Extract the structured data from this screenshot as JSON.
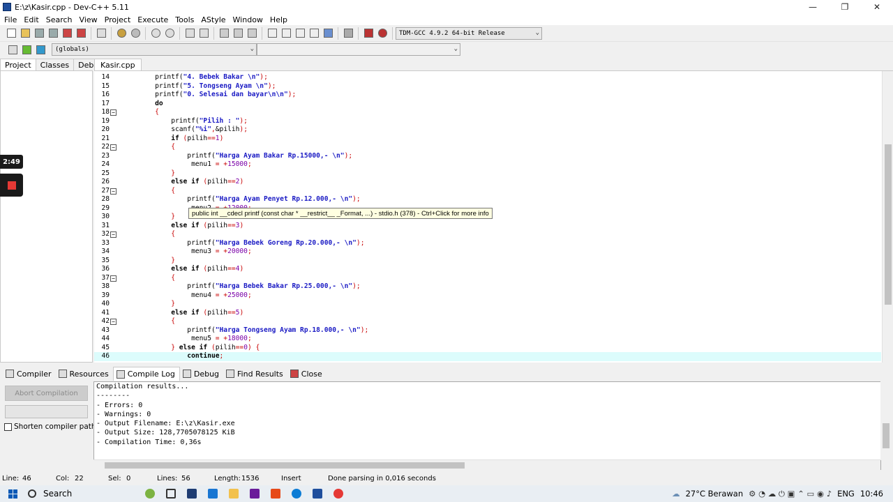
{
  "window": {
    "title": "E:\\z\\Kasir.cpp - Dev-C++ 5.11",
    "minimize": "—",
    "maximize": "❐",
    "close": "✕"
  },
  "menu": [
    "File",
    "Edit",
    "Search",
    "View",
    "Project",
    "Execute",
    "Tools",
    "AStyle",
    "Window",
    "Help"
  ],
  "toolbar": {
    "compiler_select": "TDM-GCC 4.9.2 64-bit Release",
    "scope_select": "(globals)",
    "member_select": ""
  },
  "left_tabs": [
    "Project",
    "Classes",
    "Debug"
  ],
  "editor_tab": "Kasir.cpp",
  "code_lines": [
    {
      "n": "14",
      "fold": "",
      "segs": [
        [
          "",
          "    printf("
        ],
        [
          "s",
          "\"4. Bebek Bakar \\n\""
        ],
        [
          "p",
          ");"
        ]
      ]
    },
    {
      "n": "15",
      "fold": "",
      "segs": [
        [
          "",
          "    printf("
        ],
        [
          "s",
          "\"5. Tongseng Ayam \\n\""
        ],
        [
          "p",
          ");"
        ]
      ]
    },
    {
      "n": "16",
      "fold": "",
      "segs": [
        [
          "",
          "    printf("
        ],
        [
          "s",
          "\"0. Selesai dan bayar\\n\\n\""
        ],
        [
          "p",
          ");"
        ]
      ]
    },
    {
      "n": "17",
      "fold": "",
      "segs": [
        [
          "k",
          "    do"
        ]
      ]
    },
    {
      "n": "18",
      "fold": "−",
      "segs": [
        [
          "p",
          "    {"
        ]
      ]
    },
    {
      "n": "19",
      "fold": "",
      "segs": [
        [
          "",
          "        printf("
        ],
        [
          "s",
          "\"Pilih : \""
        ],
        [
          "p",
          ");"
        ]
      ]
    },
    {
      "n": "20",
      "fold": "",
      "segs": [
        [
          "",
          "        scanf("
        ],
        [
          "s",
          "\"%i\""
        ],
        [
          "p",
          ","
        ],
        [
          "",
          "&pilih"
        ],
        [
          "p",
          ");"
        ]
      ]
    },
    {
      "n": "21",
      "fold": "",
      "segs": [
        [
          "k",
          "        if "
        ],
        [
          "p",
          "("
        ],
        [
          "",
          "pilih"
        ],
        [
          "p",
          "=="
        ],
        [
          "n",
          "1"
        ],
        [
          "p",
          ")"
        ]
      ]
    },
    {
      "n": "22",
      "fold": "−",
      "segs": [
        [
          "p",
          "        {"
        ]
      ]
    },
    {
      "n": "23",
      "fold": "",
      "segs": [
        [
          "",
          "            printf("
        ],
        [
          "s",
          "\"Harga Ayam Bakar Rp.15000,- \\n\""
        ],
        [
          "p",
          ");"
        ]
      ]
    },
    {
      "n": "24",
      "fold": "",
      "segs": [
        [
          "",
          "             menu1 "
        ],
        [
          "p",
          "= +"
        ],
        [
          "n",
          "15000"
        ],
        [
          "p",
          ";"
        ]
      ]
    },
    {
      "n": "25",
      "fold": "",
      "segs": [
        [
          "p",
          "        }"
        ]
      ]
    },
    {
      "n": "26",
      "fold": "",
      "segs": [
        [
          "k",
          "        else if "
        ],
        [
          "p",
          "("
        ],
        [
          "",
          "pilih"
        ],
        [
          "p",
          "=="
        ],
        [
          "n",
          "2"
        ],
        [
          "p",
          ")"
        ]
      ]
    },
    {
      "n": "27",
      "fold": "−",
      "segs": [
        [
          "p",
          "        {"
        ]
      ]
    },
    {
      "n": "28",
      "fold": "",
      "segs": [
        [
          "",
          "            printf("
        ],
        [
          "s",
          "\"Harga Ayam Penyet Rp.12.000,- \\n\""
        ],
        [
          "p",
          ");"
        ]
      ]
    },
    {
      "n": "29",
      "fold": "",
      "segs": [
        [
          "",
          "             menu2 "
        ],
        [
          "p",
          "= +"
        ],
        [
          "n",
          "12000"
        ],
        [
          "p",
          ";"
        ]
      ]
    },
    {
      "n": "30",
      "fold": "",
      "segs": [
        [
          "p",
          "        }"
        ]
      ]
    },
    {
      "n": "31",
      "fold": "",
      "segs": [
        [
          "k",
          "        else if "
        ],
        [
          "p",
          "("
        ],
        [
          "",
          "pilih"
        ],
        [
          "p",
          "=="
        ],
        [
          "n",
          "3"
        ],
        [
          "p",
          ")"
        ]
      ]
    },
    {
      "n": "32",
      "fold": "−",
      "segs": [
        [
          "p",
          "        {"
        ]
      ]
    },
    {
      "n": "33",
      "fold": "",
      "segs": [
        [
          "",
          "            printf("
        ],
        [
          "s",
          "\"Harga Bebek Goreng Rp.20.000,- \\n\""
        ],
        [
          "p",
          ");"
        ]
      ]
    },
    {
      "n": "34",
      "fold": "",
      "segs": [
        [
          "",
          "             menu3 "
        ],
        [
          "p",
          "= +"
        ],
        [
          "n",
          "20000"
        ],
        [
          "p",
          ";"
        ]
      ]
    },
    {
      "n": "35",
      "fold": "",
      "segs": [
        [
          "p",
          "        }"
        ]
      ]
    },
    {
      "n": "36",
      "fold": "",
      "segs": [
        [
          "k",
          "        else if "
        ],
        [
          "p",
          "("
        ],
        [
          "",
          "pilih"
        ],
        [
          "p",
          "=="
        ],
        [
          "n",
          "4"
        ],
        [
          "p",
          ")"
        ]
      ]
    },
    {
      "n": "37",
      "fold": "−",
      "segs": [
        [
          "p",
          "        {"
        ]
      ]
    },
    {
      "n": "38",
      "fold": "",
      "segs": [
        [
          "",
          "            printf("
        ],
        [
          "s",
          "\"Harga Bebek Bakar Rp.25.000,- \\n\""
        ],
        [
          "p",
          ");"
        ]
      ]
    },
    {
      "n": "39",
      "fold": "",
      "segs": [
        [
          "",
          "             menu4 "
        ],
        [
          "p",
          "= +"
        ],
        [
          "n",
          "25000"
        ],
        [
          "p",
          ";"
        ]
      ]
    },
    {
      "n": "40",
      "fold": "",
      "segs": [
        [
          "p",
          "        }"
        ]
      ]
    },
    {
      "n": "41",
      "fold": "",
      "segs": [
        [
          "k",
          "        else if "
        ],
        [
          "p",
          "("
        ],
        [
          "",
          "pilih"
        ],
        [
          "p",
          "=="
        ],
        [
          "n",
          "5"
        ],
        [
          "p",
          ")"
        ]
      ]
    },
    {
      "n": "42",
      "fold": "−",
      "segs": [
        [
          "p",
          "        {"
        ]
      ]
    },
    {
      "n": "43",
      "fold": "",
      "segs": [
        [
          "",
          "            printf("
        ],
        [
          "s",
          "\"Harga Tongseng Ayam Rp.18.000,- \\n\""
        ],
        [
          "p",
          ");"
        ]
      ]
    },
    {
      "n": "44",
      "fold": "",
      "segs": [
        [
          "",
          "             menu5 "
        ],
        [
          "p",
          "= +"
        ],
        [
          "n",
          "18000"
        ],
        [
          "p",
          ";"
        ]
      ]
    },
    {
      "n": "45",
      "fold": "",
      "segs": [
        [
          "p",
          "        } "
        ],
        [
          "k",
          "else if "
        ],
        [
          "p",
          "("
        ],
        [
          "",
          "pilih"
        ],
        [
          "p",
          "=="
        ],
        [
          "n",
          "0"
        ],
        [
          "p",
          ") {"
        ]
      ]
    },
    {
      "n": "46",
      "fold": "",
      "segs": [
        [
          "k",
          "            continue"
        ],
        [
          "p",
          ";"
        ]
      ]
    }
  ],
  "tooltip": "public int __cdecl printf (const char * __restrict__ _Format, ...) - stdio.h (378) - Ctrl+Click for more info",
  "recorder": {
    "time": "2:49"
  },
  "bottom_tabs": [
    "Compiler",
    "Resources",
    "Compile Log",
    "Debug",
    "Find Results",
    "Close"
  ],
  "abort_button": "Abort Compilation",
  "shorten_paths": "Shorten compiler paths",
  "log_lines": [
    "Compilation results...",
    "--------",
    "- Errors: 0",
    "- Warnings: 0",
    "- Output Filename: E:\\z\\Kasir.exe",
    "- Output Size: 128,7705078125 KiB",
    "- Compilation Time: 0,36s"
  ],
  "status": {
    "line_label": "Line:",
    "line": "46",
    "col_label": "Col:",
    "col": "22",
    "sel_label": "Sel:",
    "sel": "0",
    "lines_label": "Lines:",
    "lines": "56",
    "length_label": "Length:",
    "length": "1536",
    "mode": "Insert",
    "message": "Done parsing in 0,016 seconds"
  },
  "taskbar": {
    "search": "Search",
    "weather": "27°C  Berawan",
    "lang": "ENG",
    "time": "10:46"
  }
}
